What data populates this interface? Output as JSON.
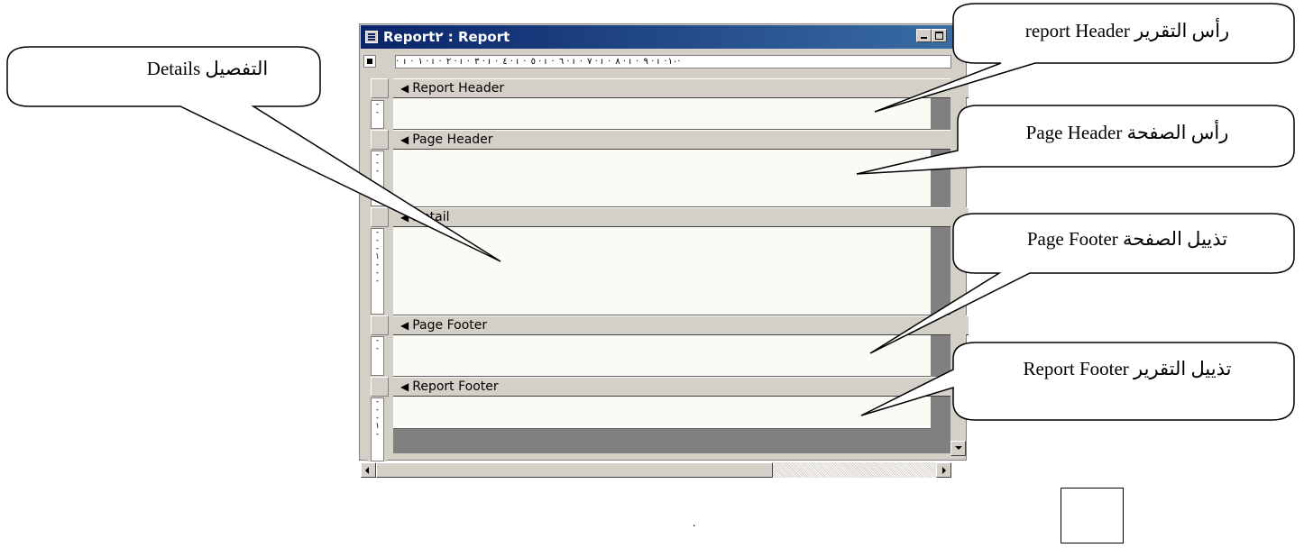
{
  "window": {
    "title": "Report٢ : Report",
    "ruler_marks": "  ·  ı  ·  ١  ·  ı  ·  ٢  ·  ı  ·  ٣  ·  ı  ·  ٤  ·  ı  ·  ٥  ·  ı  ·  ٦  ·  ı  ·  ٧  ·  ı  ·  ٨  ·  ı  ·  ٩  ·  ı  ·١٠·",
    "bands": [
      {
        "label": "Report Header"
      },
      {
        "label": "Page Header"
      },
      {
        "label": "Detail"
      },
      {
        "label": "Page Footer"
      },
      {
        "label": "Report Footer"
      }
    ]
  },
  "callouts": {
    "details": "التفصيل Details",
    "report_header": "رأس التقرير report Header",
    "page_header": "رأس الصفحة Page Header",
    "page_footer": "تذييل الصفحة Page Footer",
    "report_footer": "تذييل التقرير Report Footer"
  },
  "footer": {
    "dot": "."
  }
}
